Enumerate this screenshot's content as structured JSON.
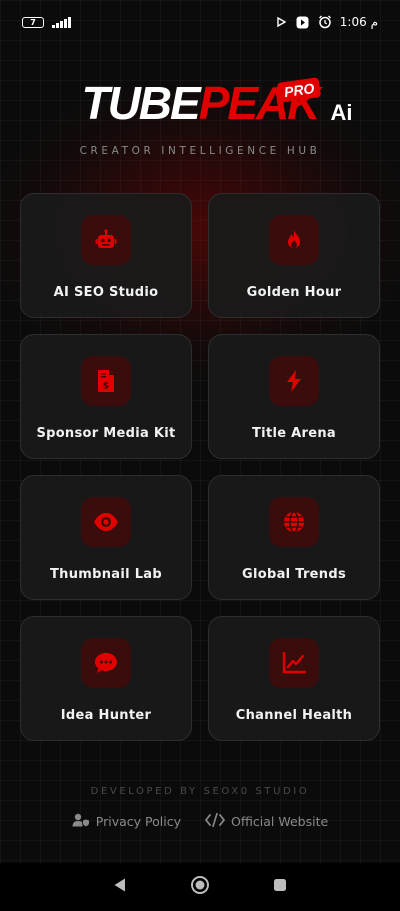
{
  "status_bar": {
    "battery": "7",
    "time": "1:06 م"
  },
  "logo": {
    "word_white": "TUBE",
    "word_red": "PEAK",
    "badge": "PRO",
    "suffix": "Ai"
  },
  "tagline": "CREATOR INTELLIGENCE HUB",
  "tools": [
    {
      "label": "AI SEO Studio",
      "icon": "robot-icon"
    },
    {
      "label": "Golden Hour",
      "icon": "flame-icon"
    },
    {
      "label": "Sponsor Media Kit",
      "icon": "invoice-icon"
    },
    {
      "label": "Title Arena",
      "icon": "lightning-icon"
    },
    {
      "label": "Thumbnail Lab",
      "icon": "eye-icon"
    },
    {
      "label": "Global Trends",
      "icon": "globe-icon"
    },
    {
      "label": "Idea Hunter",
      "icon": "chat-bubble-icon"
    },
    {
      "label": "Channel Health",
      "icon": "line-chart-icon"
    }
  ],
  "footer": {
    "developed_by": "DEVELOPED BY SEOX0 STUDIO",
    "privacy_label": "Privacy Policy",
    "website_label": "Official Website"
  },
  "colors": {
    "accent": "#e00000",
    "background": "#0b0b0b",
    "card": "#1a1a1a"
  }
}
